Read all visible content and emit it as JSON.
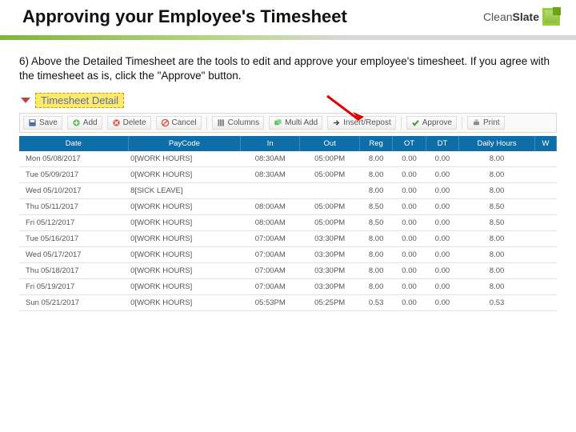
{
  "title": "Approving your Employee's Timesheet",
  "logo": {
    "name": "CleanSlate"
  },
  "body_text": "6) Above the Detailed Timesheet are the tools to edit and approve your employee's timesheet.   If you agree with the timesheet as is, click the \"Approve\" button.",
  "section_title": "Timesheet Detail",
  "toolbar": {
    "save": "Save",
    "add": "Add",
    "delete": "Delete",
    "cancel": "Cancel",
    "columns": "Columns",
    "multiadd": "Multi Add",
    "insertrepost": "Insert/Repost",
    "approve": "Approve",
    "print": "Print"
  },
  "columns": [
    "Date",
    "PayCode",
    "In",
    "Out",
    "Reg",
    "OT",
    "DT",
    "Daily Hours",
    "W"
  ],
  "rows": [
    {
      "date": "Mon 05/08/2017",
      "pc": "0[WORK HOURS]",
      "in": "08:30AM",
      "out": "05:00PM",
      "reg": "8.00",
      "ot": "0.00",
      "dt": "0.00",
      "dh": "8.00"
    },
    {
      "date": "Tue 05/09/2017",
      "pc": "0[WORK HOURS]",
      "in": "08:30AM",
      "out": "05:00PM",
      "reg": "8.00",
      "ot": "0.00",
      "dt": "0.00",
      "dh": "8.00"
    },
    {
      "date": "Wed 05/10/2017",
      "pc": "8[SICK LEAVE]",
      "in": "",
      "out": "",
      "reg": "8.00",
      "ot": "0.00",
      "dt": "0.00",
      "dh": "8.00"
    },
    {
      "date": "Thu 05/11/2017",
      "pc": "0[WORK HOURS]",
      "in": "08:00AM",
      "out": "05:00PM",
      "reg": "8.50",
      "ot": "0.00",
      "dt": "0.00",
      "dh": "8.50"
    },
    {
      "date": "Fri 05/12/2017",
      "pc": "0[WORK HOURS]",
      "in": "08:00AM",
      "out": "05:00PM",
      "reg": "8.50",
      "ot": "0.00",
      "dt": "0.00",
      "dh": "8.50"
    },
    {
      "date": "Tue 05/16/2017",
      "pc": "0[WORK HOURS]",
      "in": "07:00AM",
      "out": "03:30PM",
      "reg": "8.00",
      "ot": "0.00",
      "dt": "0.00",
      "dh": "8.00"
    },
    {
      "date": "Wed 05/17/2017",
      "pc": "0[WORK HOURS]",
      "in": "07:00AM",
      "out": "03:30PM",
      "reg": "8.00",
      "ot": "0.00",
      "dt": "0.00",
      "dh": "8.00"
    },
    {
      "date": "Thu 05/18/2017",
      "pc": "0[WORK HOURS]",
      "in": "07:00AM",
      "out": "03:30PM",
      "reg": "8.00",
      "ot": "0.00",
      "dt": "0.00",
      "dh": "8.00"
    },
    {
      "date": "Fri 05/19/2017",
      "pc": "0[WORK HOURS]",
      "in": "07:00AM",
      "out": "03:30PM",
      "reg": "8.00",
      "ot": "0.00",
      "dt": "0.00",
      "dh": "8.00"
    },
    {
      "date": "Sun 05/21/2017",
      "pc": "0[WORK HOURS]",
      "in": "05:53PM",
      "out": "05:25PM",
      "reg": "0.53",
      "ot": "0.00",
      "dt": "0.00",
      "dh": "0.53"
    }
  ]
}
